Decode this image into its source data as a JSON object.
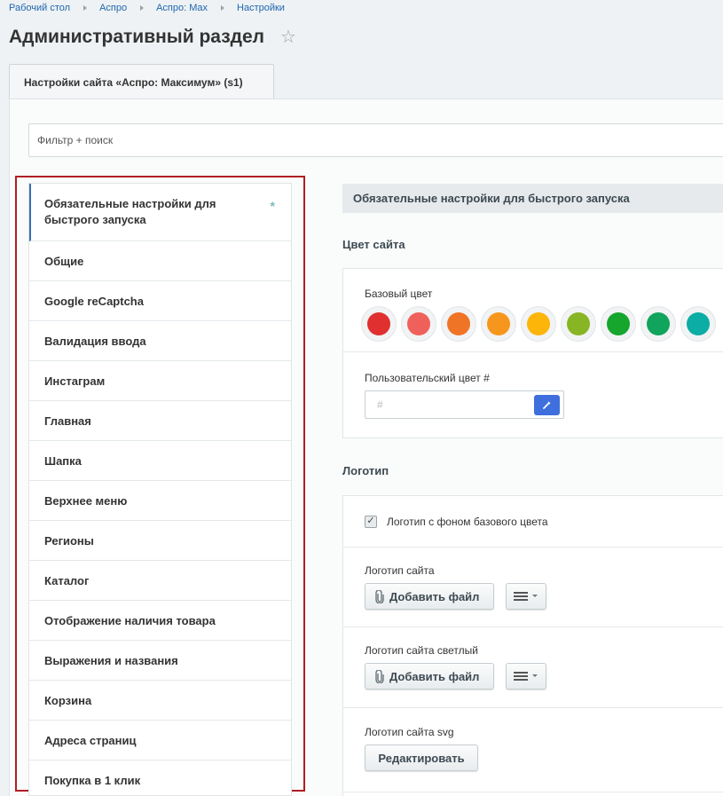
{
  "breadcrumb": [
    "Рабочий стол",
    "Аспро",
    "Аспро: Max",
    "Настройки"
  ],
  "page_title": "Административный раздел",
  "tab_label": "Настройки сайта «Аспро: Максимум» (s1)",
  "filter_placeholder": "Фильтр + поиск",
  "menu": {
    "items": [
      "Обязательные настройки для быстрого запуска",
      "Общие",
      "Google reCaptcha",
      "Валидация ввода",
      "Инстаграм",
      "Главная",
      "Шапка",
      "Верхнее меню",
      "Регионы",
      "Каталог",
      "Отображение наличия товара",
      "Выражения и названия",
      "Корзина",
      "Адреса страниц",
      "Покупка в 1 клик"
    ],
    "active_marker": "*"
  },
  "section_title": "Обязательные настройки для быстрого запуска",
  "color_group": {
    "title": "Цвет сайта",
    "base_label": "Базовый цвет",
    "swatches": [
      "#e03030",
      "#f0605b",
      "#f07425",
      "#f7961c",
      "#fcb508",
      "#87b524",
      "#16a52d",
      "#11a45c",
      "#0bada4"
    ],
    "custom_label": "Пользовательский цвет #",
    "custom_placeholder": "#"
  },
  "logo_group": {
    "title": "Логотип",
    "checkbox_label": "Логотип с фоном базового цвета",
    "checkbox_checked": true,
    "logo_label": "Логотип сайта",
    "logo_light_label": "Логотип сайта светлый",
    "logo_svg_label": "Логотип сайта svg",
    "add_file_label": "Добавить файл",
    "edit_label": "Редактировать"
  }
}
